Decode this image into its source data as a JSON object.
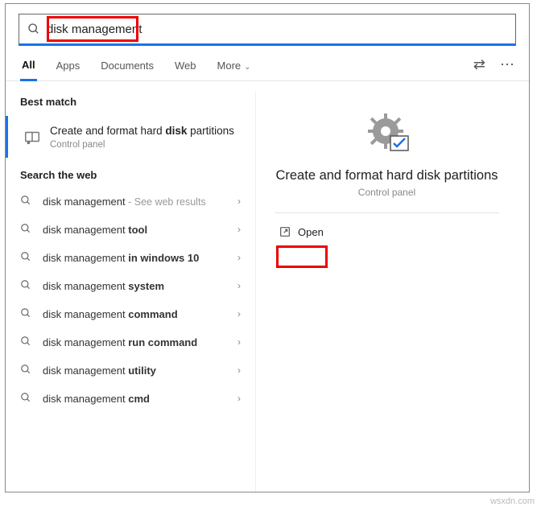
{
  "search": {
    "value": "disk management"
  },
  "tabs": {
    "all": "All",
    "apps": "Apps",
    "documents": "Documents",
    "web": "Web",
    "more": "More"
  },
  "left": {
    "best_label": "Best match",
    "best_title_pre": "Create and format hard ",
    "best_title_bold": "disk",
    "best_title_post": " partitions",
    "best_sub": "Control panel",
    "web_label": "Search the web",
    "rows": [
      {
        "pre": "disk management",
        "bold": "",
        "hint": " - See web results"
      },
      {
        "pre": "disk management ",
        "bold": "tool",
        "hint": ""
      },
      {
        "pre": "disk management ",
        "bold": "in windows 10",
        "hint": ""
      },
      {
        "pre": "disk management ",
        "bold": "system",
        "hint": ""
      },
      {
        "pre": "disk management ",
        "bold": "command",
        "hint": ""
      },
      {
        "pre": "disk management ",
        "bold": "run command",
        "hint": ""
      },
      {
        "pre": "disk management ",
        "bold": "utility",
        "hint": ""
      },
      {
        "pre": "disk management ",
        "bold": "cmd",
        "hint": ""
      }
    ]
  },
  "right": {
    "title": "Create and format hard disk partitions",
    "sub": "Control panel",
    "open": "Open"
  },
  "watermark": "wsxdn.com"
}
